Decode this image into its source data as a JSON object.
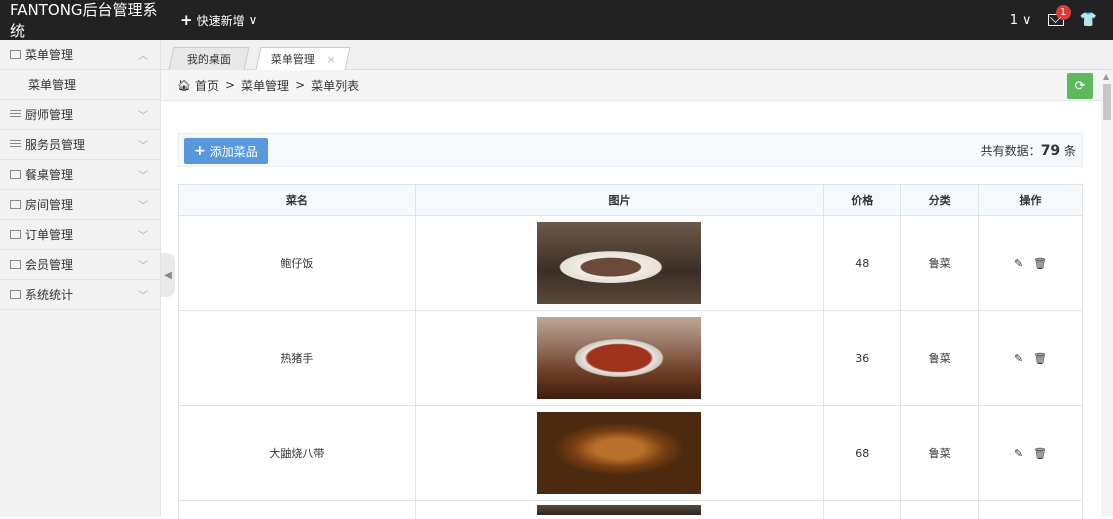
{
  "topbar": {
    "brand": "FANTONG后台管理系统",
    "quick_add": "快速新增",
    "user": "1",
    "mail_badge": "1"
  },
  "sidebar": {
    "items": [
      {
        "label": "菜单管理",
        "icon": "window-icon",
        "chevron": "up"
      },
      {
        "label": "厨师管理",
        "icon": "list-icon",
        "chevron": "down"
      },
      {
        "label": "服务员管理",
        "icon": "list-icon",
        "chevron": "down"
      },
      {
        "label": "餐桌管理",
        "icon": "window-icon",
        "chevron": "down"
      },
      {
        "label": "房间管理",
        "icon": "window-icon",
        "chevron": "down"
      },
      {
        "label": "订单管理",
        "icon": "window-icon",
        "chevron": "down"
      },
      {
        "label": "会员管理",
        "icon": "window-icon",
        "chevron": "down"
      },
      {
        "label": "系统统计",
        "icon": "window-icon",
        "chevron": "down"
      }
    ],
    "sub_item": "菜单管理"
  },
  "tabs": [
    {
      "label": "我的桌面"
    },
    {
      "label": "菜单管理",
      "close": "×",
      "active": true
    }
  ],
  "breadcrumb": {
    "home": "首页",
    "sep": ">",
    "level1": "菜单管理",
    "level2": "菜单列表"
  },
  "toolbar": {
    "add_label": "添加菜品",
    "total_prefix": "共有数据：",
    "total_count": "79",
    "total_suffix": " 条"
  },
  "table": {
    "headers": [
      "菜名",
      "图片",
      "价格",
      "分类",
      "操作"
    ],
    "rows": [
      {
        "name": "鲍仔饭",
        "price": "48",
        "category": "鲁菜"
      },
      {
        "name": "热猪手",
        "price": "36",
        "category": "鲁菜"
      },
      {
        "name": "大鼬烧八带",
        "price": "68",
        "category": "鲁菜"
      }
    ]
  },
  "colors": {
    "topbar_bg": "#222222",
    "add_button": "#5a98de",
    "refresh_button": "#5eb95e",
    "badge": "#e03b3b"
  }
}
